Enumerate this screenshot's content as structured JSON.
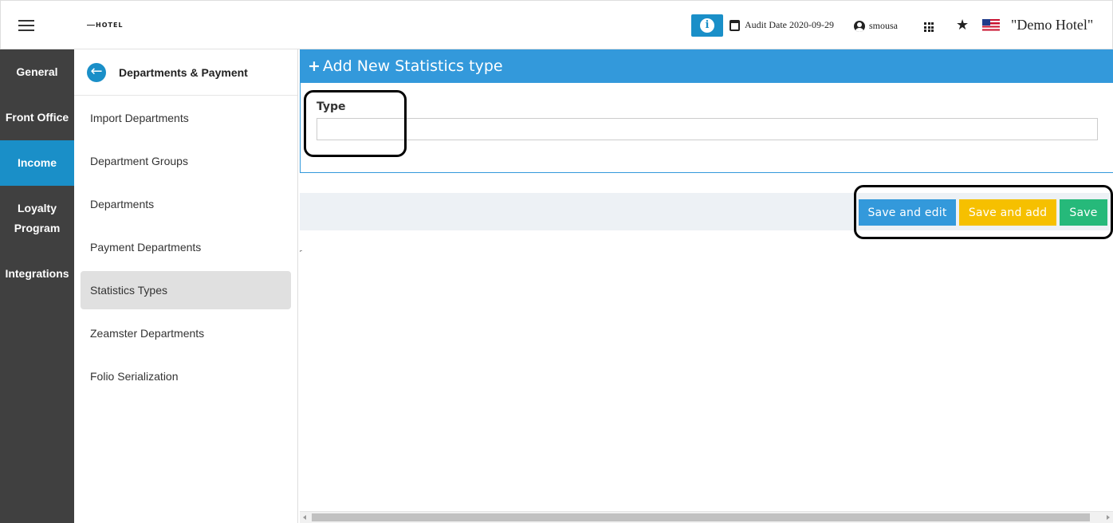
{
  "header": {
    "logo_text": "HOTEL",
    "info_symbol": "i",
    "audit_date": "Audit Date 2020-09-29",
    "username": "smousa",
    "hotel_name": "\"Demo Hotel\""
  },
  "leftnav": {
    "items": [
      {
        "label": "General"
      },
      {
        "label": "Front Office"
      },
      {
        "label": "Income"
      },
      {
        "label": "Loyalty Program"
      },
      {
        "label": "Integrations"
      }
    ]
  },
  "submenu": {
    "title": "Departments & Payment",
    "items": [
      {
        "label": "Import Departments"
      },
      {
        "label": "Department Groups"
      },
      {
        "label": "Departments"
      },
      {
        "label": "Payment Departments"
      },
      {
        "label": "Statistics Types"
      },
      {
        "label": "Zeamster Departments"
      },
      {
        "label": "Folio Serialization"
      }
    ]
  },
  "panel": {
    "plus": "+",
    "title": "Add New Statistics type",
    "type_label": "Type",
    "type_value": ""
  },
  "actions": {
    "save_edit": "Save and edit",
    "save_add": "Save and add",
    "save": "Save"
  },
  "colors": {
    "primary": "#3399db",
    "nav_bg": "#404040",
    "nav_active": "#1a8fc8",
    "warning": "#f6c000",
    "success": "#26b97a"
  }
}
